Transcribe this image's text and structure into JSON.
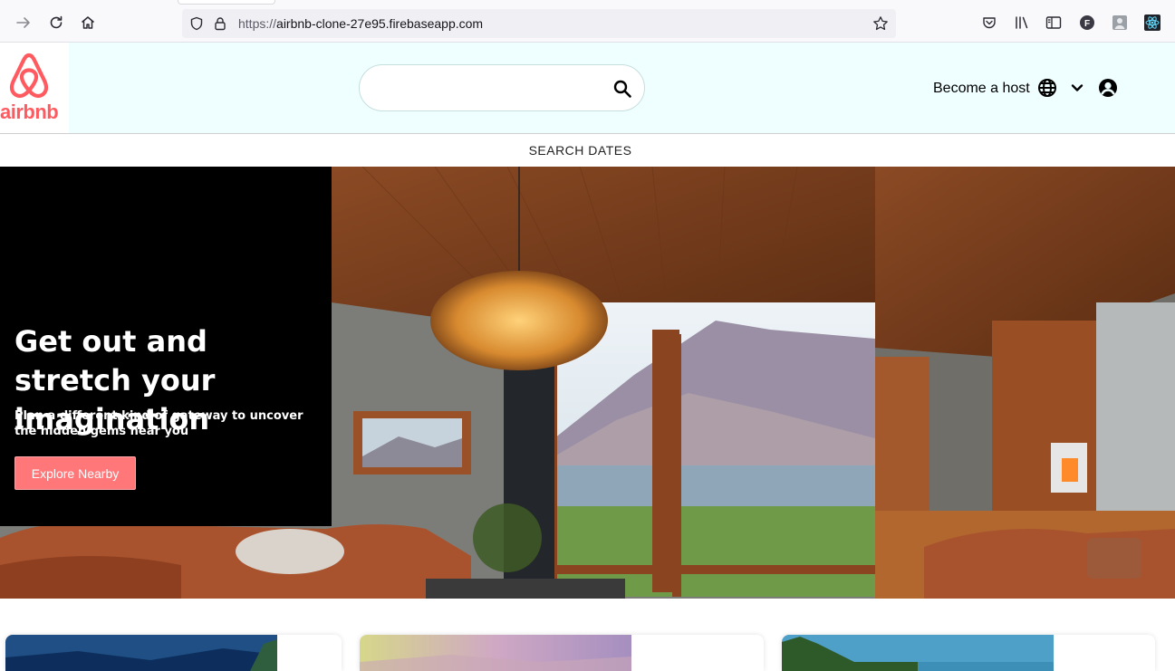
{
  "browser": {
    "url_prefix": "https://",
    "url_host": "airbnb-clone-27e95.firebaseapp.com",
    "icons": [
      "forward-icon",
      "reload-icon",
      "home-icon",
      "shield-icon",
      "lock-icon",
      "bookmark-star-icon",
      "pocket-icon",
      "library-icon",
      "sidebar-icon",
      "profile-f-icon",
      "extension-avatar-icon",
      "react-devtools-icon"
    ]
  },
  "header": {
    "logo_text": "airbnb",
    "search_placeholder": "",
    "become_host": "Become a host",
    "brand_color": "#ff5a5f"
  },
  "search_dates": {
    "label": "SEARCH DATES"
  },
  "banner": {
    "headline": "Get out and stretch your imagination",
    "subline": "Plan a different kind of gateway to uncover the hidden gems near you",
    "button_label": "Explore Nearby",
    "button_color": "#ff7779"
  },
  "cards": [
    {
      "name": "card-1"
    },
    {
      "name": "card-2"
    },
    {
      "name": "card-3"
    }
  ]
}
